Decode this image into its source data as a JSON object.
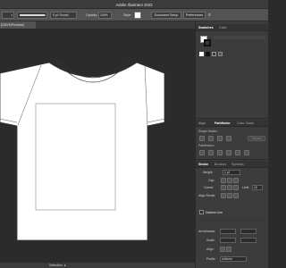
{
  "app": {
    "title": "Adobe Illustrator 2023"
  },
  "controlbar": {
    "stroke_weight": "5 pt. Round",
    "opacity_label": "Opacity:",
    "opacity_value": "100%",
    "style_label": "Style:",
    "document_setup": "Document Setup",
    "preferences": "Preferences"
  },
  "document": {
    "tab_label": "[CMYK/Preview]"
  },
  "statusbar": {
    "tool": "Selection"
  },
  "panels": {
    "swatches_tab": "Swatches",
    "color_tab": "Color",
    "align_tab": "Align",
    "pathfinder_tab": "Pathfinder",
    "color_guide_tab": "Color Guide",
    "shape_modes_label": "Shape Modes:",
    "pathfinders_label": "Pathfinders:",
    "expand_label": "Expand",
    "stroke_tab": "Stroke",
    "brushes_tab": "Brushes",
    "symbols_tab": "Symbols",
    "weight_label": "Weight:",
    "weight_value": "1 pt",
    "cap_label": "Cap:",
    "corner_label": "Corner:",
    "limit_label": "Limit:",
    "limit_value": "10",
    "align_stroke_label": "Align Stroke:",
    "dashed_line_label": "Dashed Line",
    "arrowheads_label": "Arrowheads:",
    "scale_label": "Scale:",
    "align_label": "Align:",
    "profile_label": "Profile:",
    "profile_value": "Uniform"
  },
  "colors": {
    "app_bg": "#2b2b2b",
    "panel_bg": "#3c3c3c",
    "control_bg": "#535353",
    "artboard_stroke": "#333333"
  },
  "icons": [
    "chevron-down-icon",
    "menu-icon",
    "swatch-grid-icon",
    "pathfinder-icon",
    "cap-icon",
    "corner-icon",
    "align-stroke-icon"
  ]
}
